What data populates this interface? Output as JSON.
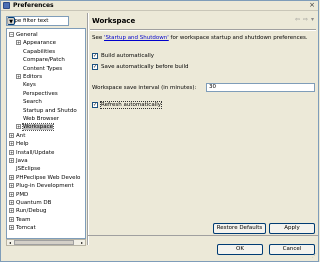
{
  "window": {
    "title": "Preferences",
    "close_glyph": "×"
  },
  "filter": {
    "value": "type filter text",
    "dropdown_glyph": "▼"
  },
  "tree": {
    "items": [
      {
        "label": "General",
        "level": 0,
        "expander": "−"
      },
      {
        "label": "Appearance",
        "level": 1,
        "expander": "+"
      },
      {
        "label": "Capabilities",
        "level": 1,
        "expander": ""
      },
      {
        "label": "Compare/Patch",
        "level": 1,
        "expander": ""
      },
      {
        "label": "Content Types",
        "level": 1,
        "expander": ""
      },
      {
        "label": "Editors",
        "level": 1,
        "expander": "+"
      },
      {
        "label": "Keys",
        "level": 1,
        "expander": ""
      },
      {
        "label": "Perspectives",
        "level": 1,
        "expander": ""
      },
      {
        "label": "Search",
        "level": 1,
        "expander": ""
      },
      {
        "label": "Startup and Shutdo",
        "level": 1,
        "expander": ""
      },
      {
        "label": "Web Browser",
        "level": 1,
        "expander": ""
      },
      {
        "label": "Workspace",
        "level": 1,
        "expander": "+",
        "selected": true
      },
      {
        "label": "Ant",
        "level": 0,
        "expander": "+"
      },
      {
        "label": "Help",
        "level": 0,
        "expander": "+"
      },
      {
        "label": "Install/Update",
        "level": 0,
        "expander": "+"
      },
      {
        "label": "Java",
        "level": 0,
        "expander": "+"
      },
      {
        "label": "JSEclipse",
        "level": 0,
        "expander": ""
      },
      {
        "label": "PHPeclipse Web Develo",
        "level": 0,
        "expander": "+"
      },
      {
        "label": "Plug-in Development",
        "level": 0,
        "expander": "+"
      },
      {
        "label": "PMD",
        "level": 0,
        "expander": "+"
      },
      {
        "label": "Quantum DB",
        "level": 0,
        "expander": "+"
      },
      {
        "label": "Run/Debug",
        "level": 0,
        "expander": "+"
      },
      {
        "label": "Team",
        "level": 0,
        "expander": "+"
      },
      {
        "label": "Tomcat",
        "level": 0,
        "expander": "+"
      }
    ]
  },
  "page": {
    "title": "Workspace",
    "nav_back": "⇦",
    "nav_forward": "⇨",
    "nav_menu": "▾",
    "desc_prefix": "See ",
    "desc_link": "'Startup and Shutdown'",
    "desc_suffix": " for workspace startup and shutdown preferences.",
    "build_auto": {
      "label": "Build automatically",
      "checked": true,
      "mark": "✓"
    },
    "save_before_build": {
      "label": "Save automatically before build",
      "checked": true,
      "mark": "✓"
    },
    "interval": {
      "label": "Workspace save interval (in minutes):",
      "value": "30"
    },
    "refresh_auto": {
      "label": "Refresh automatically",
      "checked": true,
      "mark": "✓"
    }
  },
  "buttons": {
    "restore_defaults": "Restore Defaults",
    "apply": "Apply",
    "ok": "OK",
    "cancel": "Cancel"
  },
  "grip_glyph": "⋰",
  "scroll": {
    "left": "◂",
    "right": "▸"
  }
}
